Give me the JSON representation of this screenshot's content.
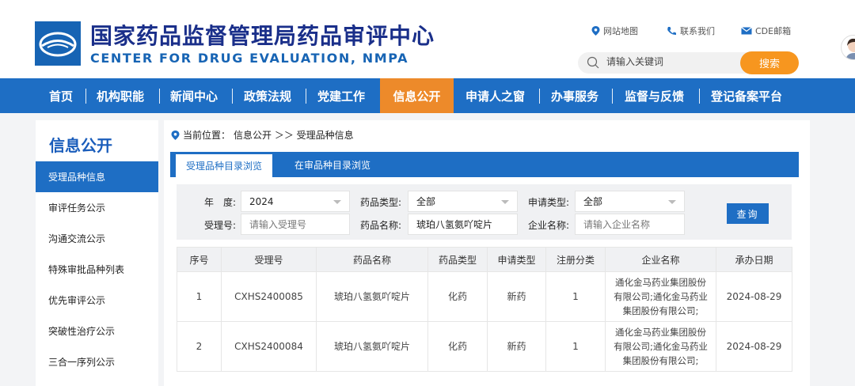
{
  "header": {
    "title_cn": "国家药品监督管理局药品审评中心",
    "title_en": "CENTER FOR DRUG EVALUATION, NMPA",
    "links": {
      "sitemap": "网站地图",
      "contact": "联系我们",
      "mail": "CDE邮箱"
    },
    "search": {
      "placeholder": "请输入关键词",
      "button": "搜索"
    },
    "accent_color": "#f7961f",
    "brand_color": "#1e6ec4"
  },
  "nav": {
    "items": [
      "首页",
      "机构职能",
      "新闻中心",
      "政策法规",
      "党建工作",
      "信息公开",
      "申请人之窗",
      "办事服务",
      "监督与反馈",
      "登记备案平台"
    ],
    "active": "信息公开"
  },
  "sidebar": {
    "title": "信息公开",
    "items": [
      "受理品种信息",
      "审评任务公示",
      "沟通交流公示",
      "特殊审批品种列表",
      "优先审评公示",
      "突破性治疗公示",
      "三合一序列公示"
    ],
    "active": "受理品种信息"
  },
  "breadcrumb": {
    "prefix": "当前位置：",
    "trail": "信息公开 ＞＞ 受理品种信息"
  },
  "tabs": [
    "受理品种目录浏览",
    "在审品种目录浏览"
  ],
  "filter": {
    "year_label": "年　度:",
    "year_value": "2024",
    "drug_type_label": "药品类型:",
    "drug_type_value": "全部",
    "apply_type_label": "申请类型:",
    "apply_type_value": "全部",
    "accept_no_label": "受理号:",
    "accept_no_placeholder": "请输入受理号",
    "drug_name_label": "药品名称:",
    "drug_name_value": "琥珀八氢氨吖啶片",
    "company_label": "企业名称:",
    "company_placeholder": "请输入企业名称",
    "query_button": "查询"
  },
  "table": {
    "headers": [
      "序号",
      "受理号",
      "药品名称",
      "药品类型",
      "申请类型",
      "注册分类",
      "企业名称",
      "承办日期"
    ],
    "rows": [
      [
        "1",
        "CXHS2400085",
        "琥珀八氢氨吖啶片",
        "化药",
        "新药",
        "1",
        "通化金马药业集团股份有限公司;通化金马药业集团股份有限公司;",
        "2024-08-29"
      ],
      [
        "2",
        "CXHS2400084",
        "琥珀八氢氨吖啶片",
        "化药",
        "新药",
        "1",
        "通化金马药业集团股份有限公司;通化金马药业集团股份有限公司;",
        "2024-08-29"
      ]
    ]
  }
}
